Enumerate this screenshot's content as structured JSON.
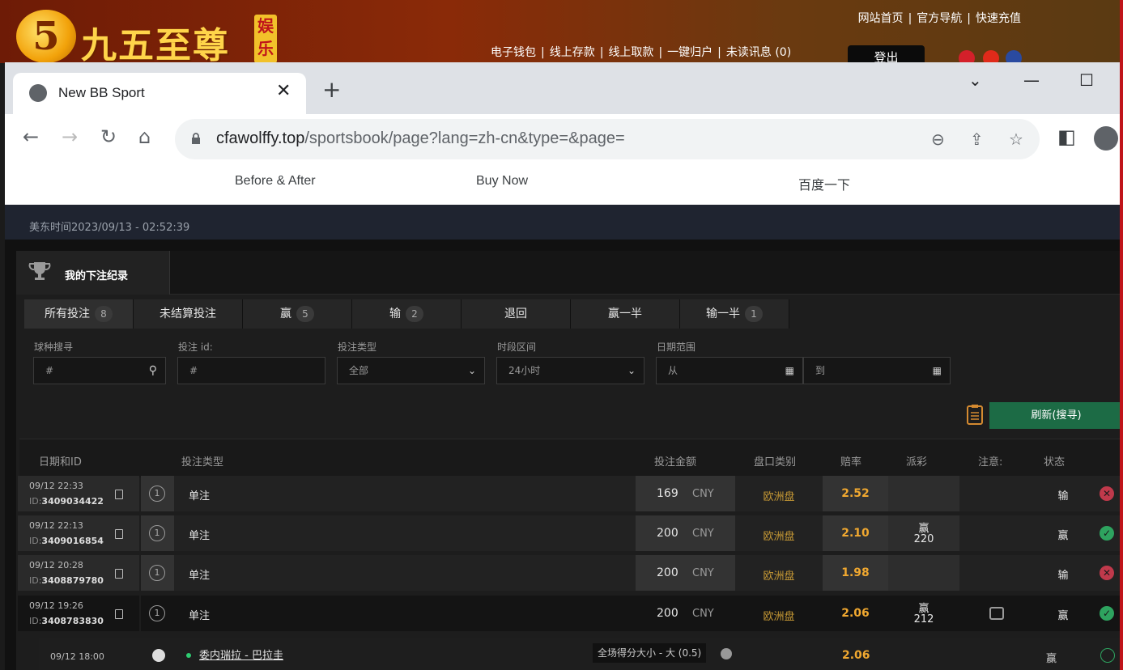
{
  "site": {
    "logo_digit": "5",
    "logo_text": "九五至尊",
    "logo_badge": "娱乐",
    "top_links": [
      "网站首页",
      "官方导航",
      "快速充值"
    ],
    "mid_links": [
      "电子钱包",
      "线上存款",
      "线上取款",
      "一键归户",
      "未读讯息 (0)"
    ],
    "logout_label": "登出"
  },
  "browser": {
    "tab_title": "New BB Sport",
    "url_domain": "cfawolffy.top",
    "url_path": "/sportsbook/page?lang=zh-cn&type=&page=",
    "bookmarks": [
      "Before & After",
      "Buy Now",
      "百度一下"
    ]
  },
  "page": {
    "time_text": "美东时间2023/09/13 - 02:52:39",
    "panel_title": "我的下注纪录",
    "filter_tabs": [
      {
        "label": "所有投注",
        "count": "8"
      },
      {
        "label": "未结算投注",
        "count": ""
      },
      {
        "label": "赢",
        "count": "5"
      },
      {
        "label": "输",
        "count": "2"
      },
      {
        "label": "退回",
        "count": ""
      },
      {
        "label": "赢一半",
        "count": ""
      },
      {
        "label": "输一半",
        "count": "1"
      }
    ],
    "filters": {
      "sport_label": "球种搜寻",
      "sport_placeholder": "#",
      "betid_label": "投注 id:",
      "betid_placeholder": "#",
      "bettype_label": "投注类型",
      "bettype_value": "全部",
      "period_label": "时段区间",
      "period_value": "24小时",
      "date_label": "日期范围",
      "date_from": "从",
      "date_to": "到"
    },
    "refresh_label": "刷新(搜寻)",
    "columns": [
      "日期和ID",
      "投注类型",
      "投注金额",
      "盘口类别",
      "赔率",
      "派彩",
      "注意:",
      "状态"
    ],
    "rows": [
      {
        "date": "09/12 22:33",
        "id_prefix": "ID:",
        "id": "3409034422",
        "num": "1",
        "type": "单注",
        "amount": "169",
        "currency": "CNY",
        "category": "欧洲盘",
        "odds": "2.52",
        "pay_label": "",
        "pay_amount": "",
        "status": "输",
        "result": "loss"
      },
      {
        "date": "09/12 22:13",
        "id_prefix": "ID:",
        "id": "3409016854",
        "num": "1",
        "type": "单注",
        "amount": "200",
        "currency": "CNY",
        "category": "欧洲盘",
        "odds": "2.10",
        "pay_label": "赢",
        "pay_amount": "220",
        "status": "赢",
        "result": "win"
      },
      {
        "date": "09/12 20:28",
        "id_prefix": "ID:",
        "id": "3408879780",
        "num": "1",
        "type": "单注",
        "amount": "200",
        "currency": "CNY",
        "category": "欧洲盘",
        "odds": "1.98",
        "pay_label": "",
        "pay_amount": "",
        "status": "输",
        "result": "loss"
      },
      {
        "date": "09/12 19:26",
        "id_prefix": "ID:",
        "id": "3408783830",
        "num": "1",
        "type": "单注",
        "amount": "200",
        "currency": "CNY",
        "category": "欧洲盘",
        "odds": "2.06",
        "pay_label": "赢",
        "pay_amount": "212",
        "status": "赢",
        "result": "win"
      }
    ],
    "sub_row": {
      "date": "09/12 18:00",
      "match": "委内瑞拉 - 巴拉圭",
      "market": "全场得分大小 - 大 (0.5)",
      "odds": "2.06",
      "status": "赢"
    }
  },
  "colors": {
    "accent_green": "#1c6b45",
    "odds_orange": "#f0a830",
    "category_gold": "#c89a35",
    "loss_red": "#c0394b",
    "win_green": "#2ea35f"
  }
}
